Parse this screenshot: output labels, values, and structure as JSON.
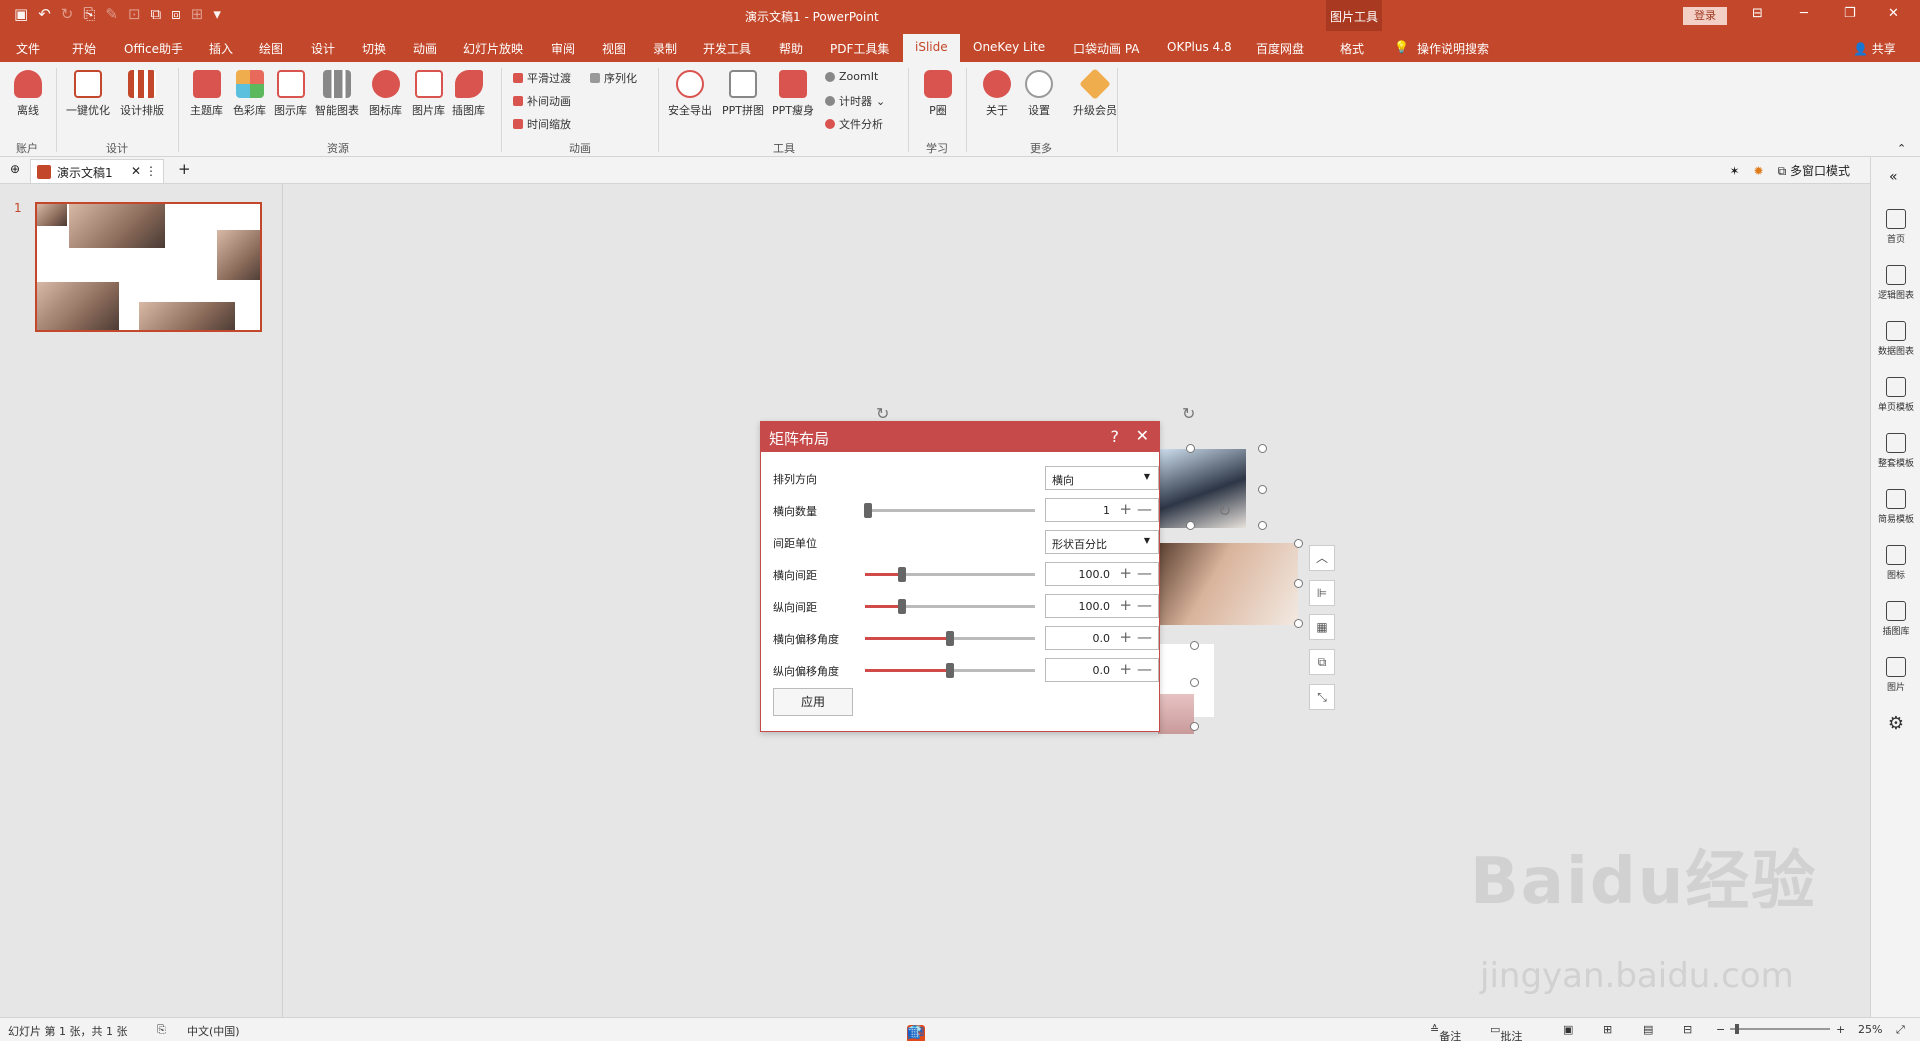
{
  "titlebar": {
    "doc_title": "演示文稿1  -  PowerPoint",
    "context_group": "图片工具",
    "login": "登录"
  },
  "tabs": [
    "文件",
    "开始",
    "Office助手",
    "插入",
    "绘图",
    "设计",
    "切换",
    "动画",
    "幻灯片放映",
    "审阅",
    "视图",
    "录制",
    "开发工具",
    "帮助",
    "PDF工具集",
    "iSlide",
    "OneKey Lite",
    "口袋动画 PA",
    "OKPlus 4.8",
    "百度网盘",
    "格式"
  ],
  "active_tab": "iSlide",
  "search_tip": "操作说明搜索",
  "share": "共享",
  "ribbon": {
    "account": {
      "btn": "离线",
      "group": "账户"
    },
    "design": {
      "btn1": "一键优化",
      "btn2": "设计排版",
      "group": "设计"
    },
    "resources": {
      "items": [
        "主题库",
        "色彩库",
        "图示库",
        "智能图表",
        "图标库",
        "图片库",
        "插图库"
      ],
      "group": "资源"
    },
    "animation": {
      "items": [
        "平滑过渡",
        "序列化",
        "补间动画",
        "时间缩放"
      ],
      "group": "动画"
    },
    "tools": {
      "big": [
        "安全导出",
        "PPT拼图",
        "PPT瘦身"
      ],
      "small": [
        "ZoomIt",
        "计时器",
        "文件分析"
      ],
      "group": "工具"
    },
    "learn": {
      "btn": "P圈",
      "group": "学习"
    },
    "more": {
      "items": [
        "关于",
        "设置",
        "升级会员"
      ],
      "group": "更多"
    }
  },
  "doc_tab": "演示文稿1",
  "multi_window": "多窗口模式",
  "slide_number": "1",
  "right_sidebar": [
    "首页",
    "逻辑图表",
    "数据图表",
    "单页模板",
    "整套模板",
    "简易模板",
    "图标",
    "插图库",
    "图片"
  ],
  "dialog": {
    "title": "矩阵布局",
    "help": "?",
    "rows": [
      {
        "label": "排列方向",
        "kind": "combo",
        "value": "横向"
      },
      {
        "label": "横向数量",
        "kind": "slider",
        "value": "1",
        "level": 0.02
      },
      {
        "label": "间距单位",
        "kind": "combo",
        "value": "形状百分比"
      },
      {
        "label": "横向间距",
        "kind": "slider",
        "value": "100.0",
        "level": 0.22
      },
      {
        "label": "纵向间距",
        "kind": "slider",
        "value": "100.0",
        "level": 0.22
      },
      {
        "label": "横向偏移角度",
        "kind": "slider",
        "value": "0.0",
        "level": 0.5
      },
      {
        "label": "纵向偏移角度",
        "kind": "slider",
        "value": "0.0",
        "level": 0.5
      }
    ],
    "apply": "应用"
  },
  "status": {
    "slide_info": "幻灯片 第 1 张，共 1 张",
    "language": "中文(中国)",
    "notes": "备注",
    "comments": "批注",
    "zoom": "25%",
    "ime_lang": "英"
  },
  "watermark": {
    "brand": "Baidu经验",
    "url": "jingyan.baidu.com"
  },
  "colors": {
    "accent": "#c3472a",
    "dialog": "#c64a4a"
  }
}
